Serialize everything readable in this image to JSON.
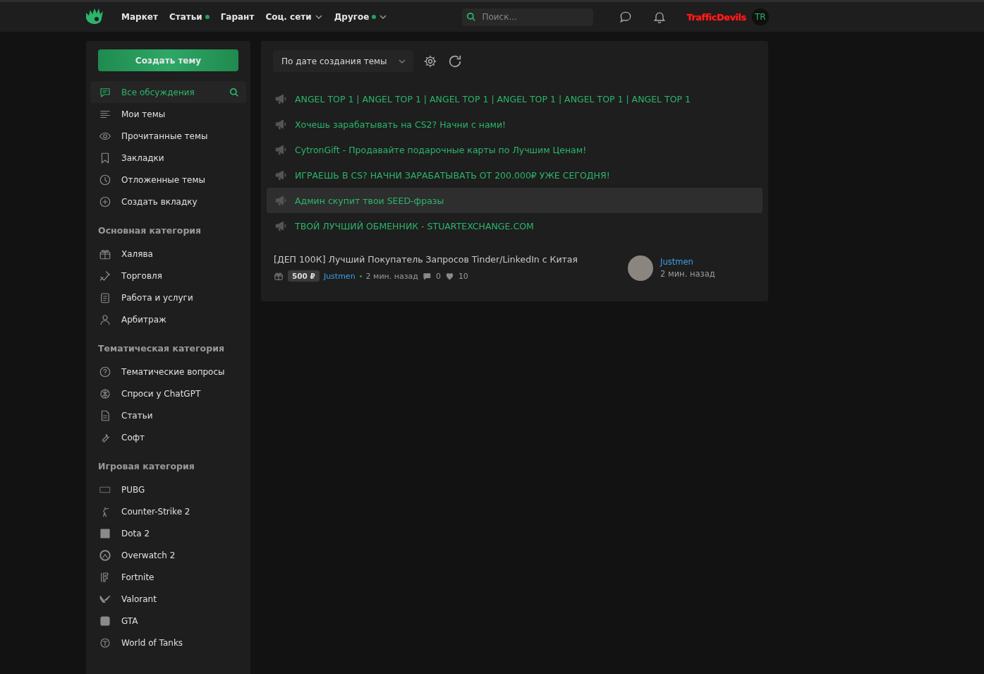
{
  "topbar": {
    "nav": [
      {
        "label": "Маркет",
        "dot": false,
        "caret": false
      },
      {
        "label": "Статьи",
        "dot": true,
        "caret": false
      },
      {
        "label": "Гарант",
        "dot": false,
        "caret": false
      },
      {
        "label": "Соц. сети",
        "dot": false,
        "caret": true
      },
      {
        "label": "Другое",
        "dot": true,
        "caret": true
      }
    ],
    "search": {
      "placeholder": "Поиск..."
    },
    "username": "TrafficDevils",
    "avatar": "TR"
  },
  "sidebar": {
    "create_button": "Создать тему",
    "items": [
      {
        "label": "Все обсуждения",
        "selected": true
      },
      {
        "label": "Мои темы",
        "selected": false
      },
      {
        "label": "Прочитанные темы",
        "selected": false
      },
      {
        "label": "Закладки",
        "selected": false
      },
      {
        "label": "Отложенные темы",
        "selected": false
      },
      {
        "label": "Создать вкладку",
        "selected": false
      }
    ],
    "sections": [
      {
        "title": "Основная категория",
        "items": [
          "Халява",
          "Торговля",
          "Работа и услуги",
          "Арбитраж"
        ]
      },
      {
        "title": "Тематическая категория",
        "items": [
          "Тематические вопросы",
          "Спроси у ChatGPT",
          "Статьи",
          "Софт"
        ]
      },
      {
        "title": "Игровая категория",
        "items": [
          "PUBG",
          "Counter-Strike 2",
          "Dota 2",
          "Overwatch 2",
          "Fortnite",
          "Valorant",
          "GTA",
          "World of Tanks"
        ]
      }
    ]
  },
  "toolbar": {
    "sort": "По дате создания темы"
  },
  "announcements": [
    {
      "text": "ANGEL TOP 1 | ANGEL TOP 1 | ANGEL TOP 1 | ANGEL TOP 1 | ANGEL TOP 1 | ANGEL TOP 1",
      "highlighted": false
    },
    {
      "text": "Хочешь зарабатывать на CS2? Начни с нами!",
      "highlighted": false
    },
    {
      "text": "CytronGift - Продавайте подарочные карты по Лучшим Ценам!",
      "highlighted": false
    },
    {
      "text": "ИГРАЕШЬ В CS? НАЧНИ ЗАРАБАТЫВАТЬ ОТ 200.000₽ УЖЕ СЕГОДНЯ!",
      "highlighted": false
    },
    {
      "text": "Админ скупит твои SEED-фразы",
      "highlighted": true
    },
    {
      "text": "ТВОЙ ЛУЧШИЙ ОБМЕННИК - STUARTEXCHANGE.COM",
      "highlighted": false
    }
  ],
  "threads": [
    {
      "title": "[ДЕП 100К] Лучший Покупатель Запросов Tinder/LinkedIn с Китая",
      "prize": "500 ₽",
      "author": "Justmen",
      "time": "2 мин. назад",
      "replies": "0",
      "likes": "10",
      "last_author": "Justmen",
      "last_time": "2 мин. назад"
    }
  ]
}
